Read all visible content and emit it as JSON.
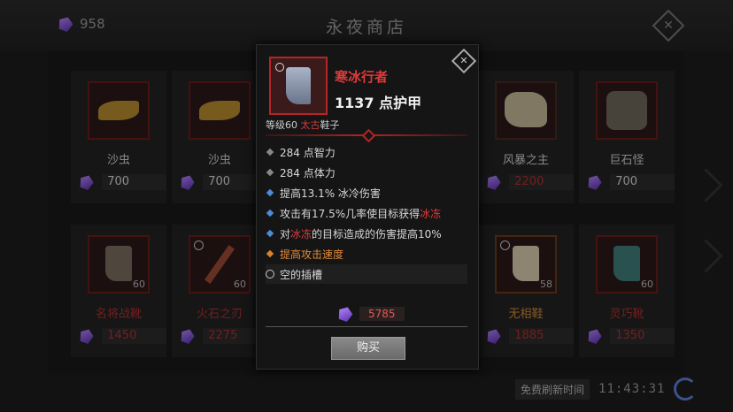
{
  "header": {
    "currency_value": "958",
    "title": "永夜商店",
    "close_label": "✕"
  },
  "items": [
    {
      "name": "沙虫",
      "price": "700",
      "level": "",
      "price_color": "#cfcfcf",
      "name_color": "#cfcfcf",
      "icon": "sandworm-icon"
    },
    {
      "name": "沙虫",
      "price": "700",
      "level": "",
      "price_color": "#cfcfcf",
      "name_color": "#cfcfcf",
      "icon": "sandworm-icon"
    },
    {
      "name": "风暴之主",
      "price": "2200",
      "level": "",
      "price_color": "#b03030",
      "name_color": "#b03030",
      "icon": "storm-lord-icon"
    },
    {
      "name": "巨石怪",
      "price": "700",
      "level": "",
      "price_color": "#cfcfcf",
      "name_color": "#cfcfcf",
      "icon": "stone-golem-icon"
    },
    {
      "name": "名将战靴",
      "price": "1450",
      "level": "60",
      "price_color": "#b03030",
      "name_color": "#b03030",
      "icon": "boots-icon"
    },
    {
      "name": "火石之刃",
      "price": "2275",
      "level": "60",
      "price_color": "#b03030",
      "name_color": "#b03030",
      "icon": "dagger-icon"
    },
    {
      "name": "无相鞋",
      "price": "1885",
      "level": "58",
      "price_color": "#b03030",
      "name_color": "#d08a3a",
      "icon": "white-boots-icon"
    },
    {
      "name": "灵巧靴",
      "price": "1350",
      "level": "60",
      "price_color": "#b03030",
      "name_color": "#b03030",
      "icon": "teal-boots-icon"
    }
  ],
  "refresh": {
    "label": "免费刷新时间",
    "time": "11:43:31"
  },
  "tooltip": {
    "name": "寒冰行者",
    "armor": "1137 点护甲",
    "level_prefix": "等级60",
    "quality": "太古",
    "slot": "鞋子",
    "stats": {
      "s1": "284 点智力",
      "s2": "284 点体力",
      "s3": "提高13.1% 冰冷伤害",
      "s4_a": "攻击有17.5%几率使目标获得",
      "s4_b": "冰冻",
      "s5_a": "对",
      "s5_b": "冰冻",
      "s5_c": "的目标造成的伤害提高10%",
      "s6": "提高攻击速度",
      "s7": "空的插槽"
    },
    "price": "5785",
    "buy_label": "购买",
    "close_label": "✕"
  },
  "colors": {
    "accent_red": "#e03a3a",
    "magic_blue": "#4c8bd8",
    "legendary_orange": "#e08a3a",
    "gem_purple": "#8a5ad8"
  }
}
